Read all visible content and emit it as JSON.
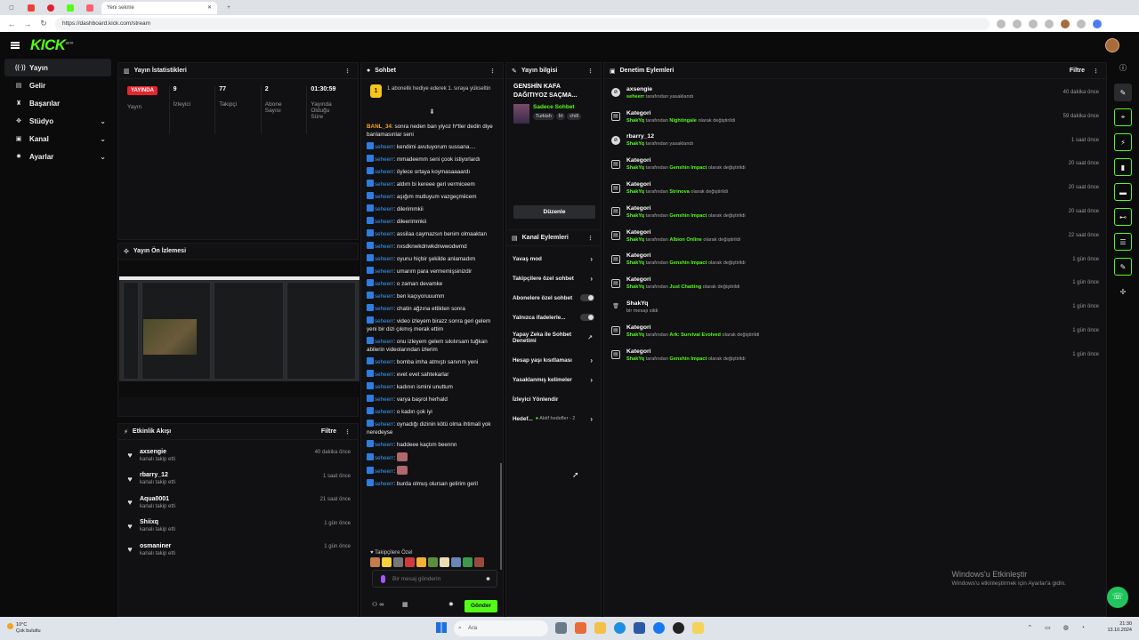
{
  "browser": {
    "tab_title": "Yeni sekme",
    "url": "https://dashboard.kick.com/stream"
  },
  "app": {
    "logo": "KICK",
    "logo_sup": "BETA"
  },
  "sidebar": {
    "items": [
      {
        "label": "Yayın",
        "icon": "broadcast-icon"
      },
      {
        "label": "Gelir",
        "icon": "revenue-icon"
      },
      {
        "label": "Başarılar",
        "icon": "trophy-icon"
      },
      {
        "label": "Stüdyo",
        "icon": "studio-icon"
      },
      {
        "label": "Kanal",
        "icon": "channel-icon"
      },
      {
        "label": "Ayarlar",
        "icon": "gear-icon"
      }
    ]
  },
  "stats": {
    "title": "Yayın İstatistikleri",
    "live_badge": "YAYINDA",
    "live_label": "Yayın",
    "items": [
      {
        "value": "9",
        "label": "İzleyici"
      },
      {
        "value": "77",
        "label": "Takipçi"
      },
      {
        "value": "2",
        "label": "Abone Sayısı"
      },
      {
        "value": "01:30:59",
        "label": "Yayında Olduğu Süre"
      }
    ]
  },
  "preview": {
    "title": "Yayın Ön İzlemesi"
  },
  "activity": {
    "title": "Etkinlik Akışı",
    "filter": "Filtre",
    "items": [
      {
        "name": "axsengie",
        "sub": "kanalı takip etti",
        "time": "40 dakika önce"
      },
      {
        "name": "rbarry_12",
        "sub": "kanalı takip etti",
        "time": "1 saat önce"
      },
      {
        "name": "Aqua0001",
        "sub": "kanalı takip etti",
        "time": "21 saat önce"
      },
      {
        "name": "Shiixq",
        "sub": "kanalı takip etti",
        "time": "1 gün önce"
      },
      {
        "name": "osmaniner",
        "sub": "kanalı takip etti",
        "time": "1 gün önce"
      }
    ]
  },
  "chat": {
    "title": "Sohbet",
    "gift_count": "1",
    "gift_text": "1 abonelik hediye ederek 1. sıraya yükseltin",
    "messages": [
      {
        "user": "BANL_34",
        "text": ": sonra neden ban yiyoz h*tler dedin diye banlamasınlar seni",
        "special": true
      },
      {
        "user": "seheerr",
        "text": ": kendimi avutuyorum sussana...."
      },
      {
        "user": "seheerr",
        "text": ": mmadeemm seni çook istiyorlardı"
      },
      {
        "user": "seheerr",
        "text": ": öylece ortaya koymasaaaardı"
      },
      {
        "user": "seheerr",
        "text": ": aldım bi kereee geri vermiceem"
      },
      {
        "user": "seheerr",
        "text": ": aşığım mutluyum vazgeçmiicem"
      },
      {
        "user": "seheerr",
        "text": ": dilerimmkii"
      },
      {
        "user": "seheerr",
        "text": ": dileerimmkii"
      },
      {
        "user": "seheerr",
        "text": ": assilaa caymazsın benim olmaaktan"
      },
      {
        "user": "seheerr",
        "text": ": nxsdknwkdnwkdnwwodwmd"
      },
      {
        "user": "seheerr",
        "text": ": oyunu hiçbir şekilde anlamadım"
      },
      {
        "user": "seheerr",
        "text": ": umarım para vermemişsinizdir"
      },
      {
        "user": "seheerr",
        "text": ": o zaman devamke"
      },
      {
        "user": "seheerr",
        "text": ": ben kaçıyoruuumm"
      },
      {
        "user": "seheerr",
        "text": ": chatin ağzına ettikten sonra"
      },
      {
        "user": "seheerr",
        "text": ": video izleyem birazz sonra geri gelem yeni bir dizi çıkmış merak ettim"
      },
      {
        "user": "seheerr",
        "text": ": onu izleyem gelem sıkılırsam tuğkan abilerin videolarından izlerim"
      },
      {
        "user": "seheerr",
        "text": ": bomba imha atmıştı sanırım yeni"
      },
      {
        "user": "seheerr",
        "text": ": evet evet sahtekarlar"
      },
      {
        "user": "seheerr",
        "text": ": kadının ismini unuttum"
      },
      {
        "user": "seheerr",
        "text": ": varya başrol herhald"
      },
      {
        "user": "seheerr",
        "text": ": o kadın çok iyi"
      },
      {
        "user": "seheerr",
        "text": ": oynadığı dizinin kötü olma ihtimali yok neredeyse"
      },
      {
        "user": "seheerr",
        "text": ": haddeee kaçtım beennn"
      },
      {
        "user": "seheerr",
        "text": ":"
      },
      {
        "user": "seheerr",
        "text": ":"
      },
      {
        "user": "seheerr",
        "text": ": burda olmuş olursan gelirim geril"
      }
    ],
    "followers_only": "Takipçilere Özel",
    "input_placeholder": "Bir mesaj gönderin",
    "send": "Gönder",
    "points": "∞"
  },
  "info": {
    "title": "Yayın bilgisi",
    "stream_title": "GENSHİN KAFA DAĞITIYOZ SAÇMA...",
    "category": "Sadece Sohbet",
    "tags": [
      "Turkish",
      "İrl",
      "chill"
    ],
    "edit": "Düzenle"
  },
  "channel_actions": {
    "title": "Kanal Eylemleri",
    "items": [
      {
        "label": "Yavaş mod",
        "kind": "arrow"
      },
      {
        "label": "Takipçilere özel sohbet",
        "kind": "arrow"
      },
      {
        "label": "Abonelere özel sohbet",
        "kind": "toggle"
      },
      {
        "label": "Yalnızca ifadelerle...",
        "kind": "toggle"
      },
      {
        "label": "Yapay Zeka ile Sohbet Denetimi",
        "kind": "external"
      },
      {
        "label": "Hesap yaşı kısıtlaması",
        "kind": "arrow"
      },
      {
        "label": "Yasaklanmış kelimeler",
        "kind": "arrow"
      },
      {
        "label": "İzleyici Yönlendir",
        "kind": "none"
      },
      {
        "label": "Hedef...",
        "kind": "arrow",
        "sub": "Aktif hedefler - 2"
      }
    ]
  },
  "moderation": {
    "title": "Denetim Eylemleri",
    "filter": "Filtre",
    "rows": [
      {
        "icon": "ban-icon",
        "title": "axsengie",
        "actor": "seheerr",
        "mid": " tarafından yasaklandı",
        "target": "",
        "tail": "",
        "time": "40 dakika önce"
      },
      {
        "icon": "category-icon",
        "title": "Kategori",
        "actor": "ShakYq",
        "mid": " tarafından ",
        "target": "Nightingale",
        "tail": " olarak değiştirildi",
        "time": "59 dakika önce"
      },
      {
        "icon": "ban-icon",
        "title": "rbarry_12",
        "actor": "ShakYq",
        "mid": " tarafından yasaklandı",
        "target": "",
        "tail": "",
        "time": "1 saat önce"
      },
      {
        "icon": "category-icon",
        "title": "Kategori",
        "actor": "ShakYq",
        "mid": " tarafından ",
        "target": "Genshin Impact",
        "tail": " olarak değiştirildi",
        "time": "20 saat önce"
      },
      {
        "icon": "category-icon",
        "title": "Kategori",
        "actor": "ShakYq",
        "mid": " tarafından ",
        "target": "Strinova",
        "tail": " olarak değiştirildi",
        "time": "20 saat önce"
      },
      {
        "icon": "category-icon",
        "title": "Kategori",
        "actor": "ShakYq",
        "mid": " tarafından ",
        "target": "Genshin Impact",
        "tail": " olarak değiştirildi",
        "time": "20 saat önce"
      },
      {
        "icon": "category-icon",
        "title": "Kategori",
        "actor": "ShakYq",
        "mid": " tarafından ",
        "target": "Albion Online",
        "tail": " olarak değiştirildi",
        "time": "22 saat önce"
      },
      {
        "icon": "category-icon",
        "title": "Kategori",
        "actor": "ShakYq",
        "mid": " tarafından ",
        "target": "Genshin Impact",
        "tail": " olarak değiştirildi",
        "time": "1 gün önce"
      },
      {
        "icon": "category-icon",
        "title": "Kategori",
        "actor": "ShakYq",
        "mid": " tarafından ",
        "target": "Just Chatting",
        "tail": " olarak değiştirildi",
        "time": "1 gün önce"
      },
      {
        "icon": "trash-icon",
        "title": "ShakYq",
        "actor": "",
        "mid": "bir mesajı sildi",
        "target": "",
        "tail": "",
        "time": "1 gün önce"
      },
      {
        "icon": "category-icon",
        "title": "Kategori",
        "actor": "ShakYq",
        "mid": " tarafından ",
        "target": "Ark: Survival Evolved",
        "tail": " olarak değiştirildi",
        "time": "1 gün önce"
      },
      {
        "icon": "category-icon",
        "title": "Kategori",
        "actor": "ShakYq",
        "mid": " tarafından ",
        "target": "Genshin Impact",
        "tail": " olarak değiştirildi",
        "time": "1 gün önce"
      }
    ]
  },
  "watermark": {
    "line1": "Windows'u Etkinleştir",
    "line2": "Windows'u etkinleştirmek için Ayarlar'a gidin."
  },
  "taskbar": {
    "temp": "10°C",
    "weather": "Çok bulutlu",
    "search": "Ara",
    "time": "21:30",
    "date": "13.10.2024"
  },
  "colors": {
    "accent": "#53fc18",
    "live": "#e5262f",
    "chat_user": "#3a9cf4"
  }
}
